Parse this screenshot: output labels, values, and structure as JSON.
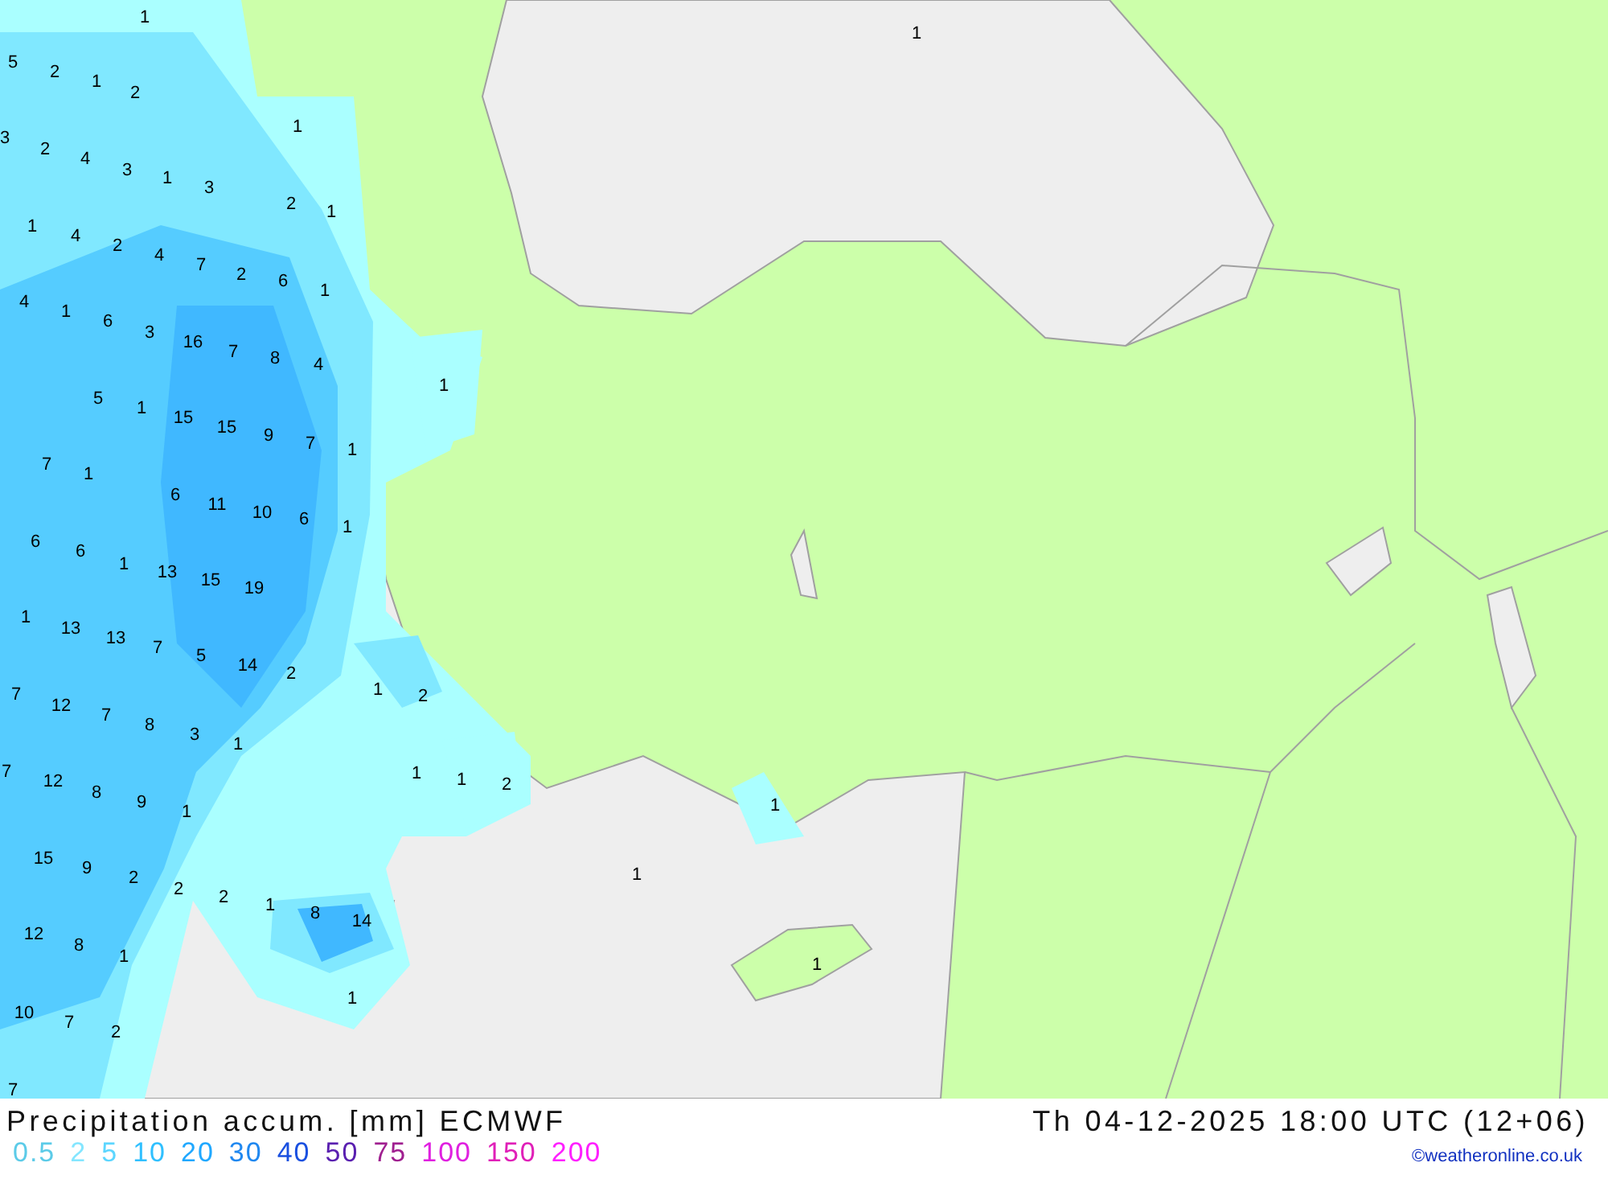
{
  "map": {
    "labels": [
      {
        "text": "1"
      },
      {
        "text": "1"
      },
      {
        "text": "5"
      },
      {
        "text": "2"
      },
      {
        "text": "1"
      },
      {
        "text": "2"
      },
      {
        "text": "3"
      },
      {
        "text": "2"
      },
      {
        "text": "4"
      },
      {
        "text": "3"
      },
      {
        "text": "1"
      },
      {
        "text": "3"
      },
      {
        "text": "1"
      },
      {
        "text": "2"
      },
      {
        "text": "1"
      },
      {
        "text": "1"
      },
      {
        "text": "4"
      },
      {
        "text": "2"
      },
      {
        "text": "4"
      },
      {
        "text": "7"
      },
      {
        "text": "2"
      },
      {
        "text": "6"
      },
      {
        "text": "1"
      },
      {
        "text": "4"
      },
      {
        "text": "1"
      },
      {
        "text": "6"
      },
      {
        "text": "3"
      },
      {
        "text": "16"
      },
      {
        "text": "7"
      },
      {
        "text": "8"
      },
      {
        "text": "4"
      },
      {
        "text": "1"
      },
      {
        "text": "5"
      },
      {
        "text": "1"
      },
      {
        "text": "15"
      },
      {
        "text": "15"
      },
      {
        "text": "9"
      },
      {
        "text": "7"
      },
      {
        "text": "1"
      },
      {
        "text": "7"
      },
      {
        "text": "1"
      },
      {
        "text": "6"
      },
      {
        "text": "11"
      },
      {
        "text": "10"
      },
      {
        "text": "6"
      },
      {
        "text": "1"
      },
      {
        "text": "6"
      },
      {
        "text": "6"
      },
      {
        "text": "1"
      },
      {
        "text": "13"
      },
      {
        "text": "15"
      },
      {
        "text": "19"
      },
      {
        "text": "1"
      },
      {
        "text": "13"
      },
      {
        "text": "13"
      },
      {
        "text": "7"
      },
      {
        "text": "5"
      },
      {
        "text": "14"
      },
      {
        "text": "2"
      },
      {
        "text": "7"
      },
      {
        "text": "12"
      },
      {
        "text": "7"
      },
      {
        "text": "8"
      },
      {
        "text": "3"
      },
      {
        "text": "1"
      },
      {
        "text": "1"
      },
      {
        "text": "2"
      },
      {
        "text": "7"
      },
      {
        "text": "12"
      },
      {
        "text": "8"
      },
      {
        "text": "9"
      },
      {
        "text": "1"
      },
      {
        "text": "1"
      },
      {
        "text": "1"
      },
      {
        "text": "2"
      },
      {
        "text": "1"
      },
      {
        "text": "15"
      },
      {
        "text": "9"
      },
      {
        "text": "2"
      },
      {
        "text": "2"
      },
      {
        "text": "2"
      },
      {
        "text": "1"
      },
      {
        "text": "8"
      },
      {
        "text": "14"
      },
      {
        "text": "1"
      },
      {
        "text": "12"
      },
      {
        "text": "8"
      },
      {
        "text": "1"
      },
      {
        "text": "1"
      },
      {
        "text": "10"
      },
      {
        "text": "7"
      },
      {
        "text": "2"
      },
      {
        "text": "7"
      },
      {
        "text": "1"
      }
    ]
  },
  "footer": {
    "title": "Precipitation accum. [mm] ECMWF",
    "valid_time": "Th 04-12-2025 18:00 UTC (12+06)",
    "legend": [
      {
        "label": "0.5",
        "color": "#5ccbe8"
      },
      {
        "label": "2",
        "color": "#84e6ff"
      },
      {
        "label": "5",
        "color": "#5cd6ff"
      },
      {
        "label": "10",
        "color": "#30c0ff"
      },
      {
        "label": "20",
        "color": "#20a8ff"
      },
      {
        "label": "30",
        "color": "#2088f0"
      },
      {
        "label": "40",
        "color": "#1a50e0"
      },
      {
        "label": "50",
        "color": "#5a20b0"
      },
      {
        "label": "75",
        "color": "#a02090"
      },
      {
        "label": "100",
        "color": "#e020e0"
      },
      {
        "label": "150",
        "color": "#e020b8"
      },
      {
        "label": "200",
        "color": "#ff20ff"
      }
    ],
    "credit": "©weatheronline.co.uk"
  }
}
